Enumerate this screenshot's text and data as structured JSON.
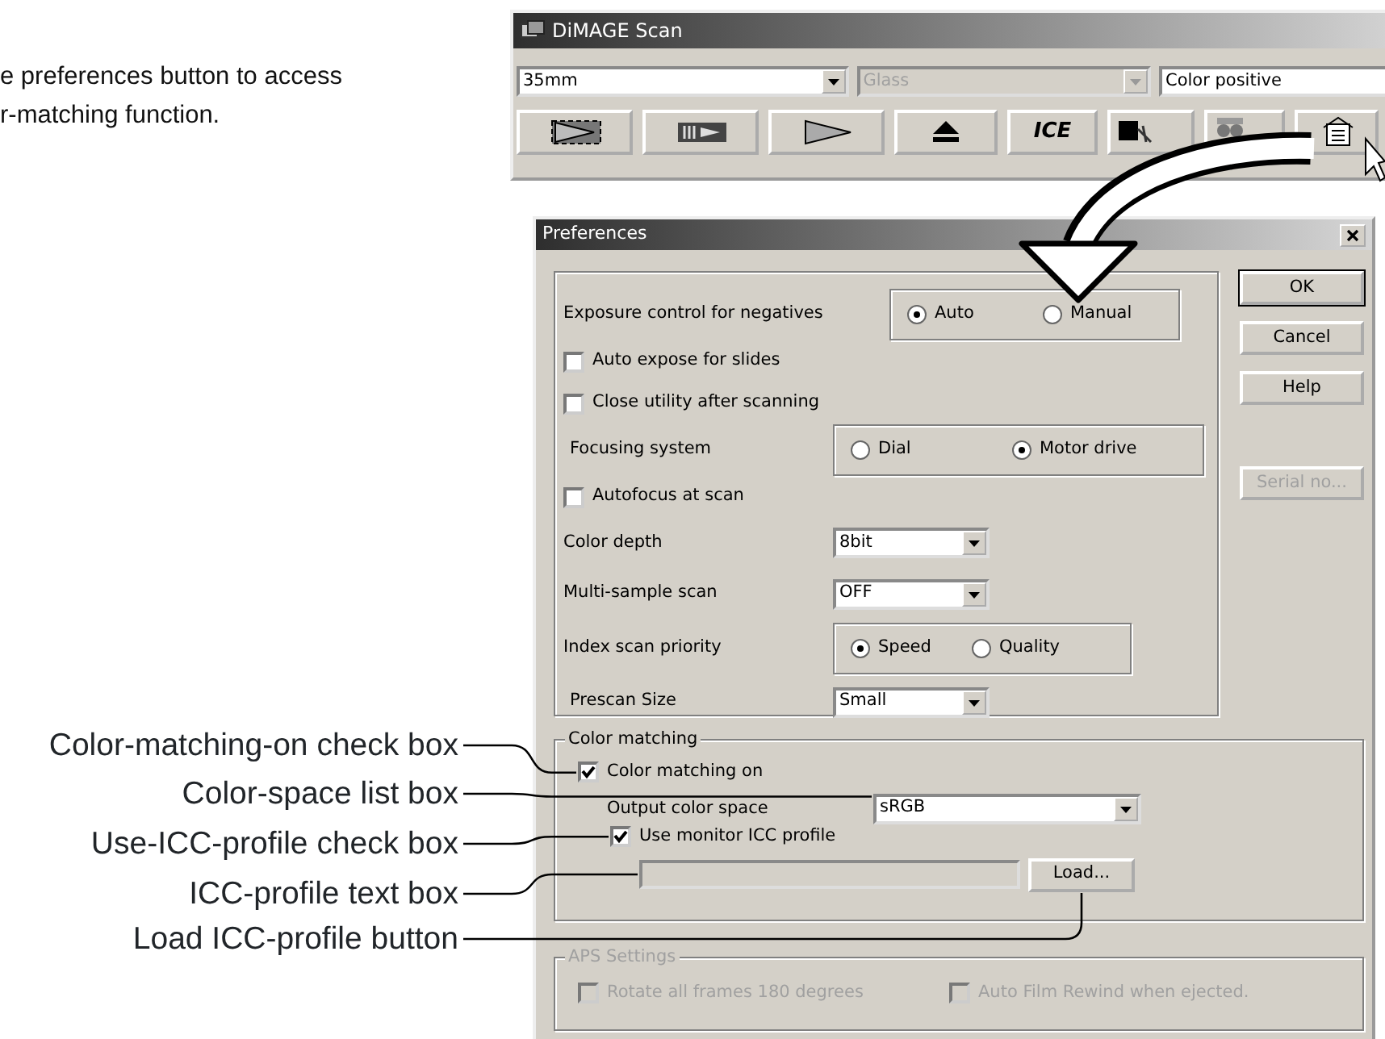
{
  "intro_lines": [
    "e preferences button to access",
    "r-matching function."
  ],
  "main_window": {
    "title": "DiMAGE Scan",
    "dropdowns": [
      {
        "value": "35mm",
        "disabled": false
      },
      {
        "value": "Glass",
        "disabled": true
      },
      {
        "value": "Color positive",
        "disabled": false
      }
    ],
    "toolbar_buttons": [
      {
        "kind": "index"
      },
      {
        "kind": "prescan"
      },
      {
        "kind": "scan"
      },
      {
        "kind": "eject"
      },
      {
        "kind": "ice",
        "label": "ICE"
      },
      {
        "kind": "dust"
      },
      {
        "kind": "grain"
      },
      {
        "kind": "preferences"
      }
    ]
  },
  "preferences_dialog": {
    "title": "Preferences",
    "settings": [
      {
        "kind": "radio",
        "label": "Exposure control for negatives",
        "options": [
          {
            "label": "Auto",
            "selected": true
          },
          {
            "label": "Manual",
            "selected": false
          }
        ]
      },
      {
        "kind": "checkbox",
        "label": "Auto expose for slides",
        "checked": false
      },
      {
        "kind": "checkbox",
        "label": "Close utility after scanning",
        "checked": false
      },
      {
        "kind": "radio",
        "label": "Focusing system",
        "options": [
          {
            "label": "Dial",
            "selected": false
          },
          {
            "label": "Motor drive",
            "selected": true
          }
        ]
      },
      {
        "kind": "checkbox",
        "label": "Autofocus at scan",
        "checked": false
      },
      {
        "kind": "select",
        "label": "Color depth",
        "value": "8bit"
      },
      {
        "kind": "select",
        "label": "Multi-sample scan",
        "value": "OFF"
      },
      {
        "kind": "radio",
        "label": "Index scan priority",
        "options": [
          {
            "label": "Speed",
            "selected": true
          },
          {
            "label": "Quality",
            "selected": false
          }
        ]
      },
      {
        "kind": "select",
        "label": "Prescan Size",
        "value": "Small"
      }
    ],
    "buttons": [
      {
        "label": "OK",
        "default": true,
        "disabled": false
      },
      {
        "label": "Cancel",
        "default": false,
        "disabled": false
      },
      {
        "label": "Help",
        "default": false,
        "disabled": false
      },
      {
        "label": "Serial no...",
        "default": false,
        "disabled": true
      }
    ],
    "color_matching": {
      "title": "Color matching",
      "color_matching_on": {
        "label": "Color matching on",
        "checked": true
      },
      "output_color_space": {
        "label": "Output color space",
        "value": "sRGB"
      },
      "use_monitor_profile": {
        "label": "Use monitor ICC profile",
        "checked": true
      },
      "load_button": "Load..."
    },
    "aps_settings": {
      "title": "APS Settings",
      "disabled": true,
      "options": [
        {
          "label": "Rotate all frames 180 degrees",
          "checked": false
        },
        {
          "label": "Auto Film Rewind when ejected.",
          "checked": false
        }
      ]
    }
  },
  "callouts": [
    "Color-matching-on check box",
    "Color-space list box",
    "Use-ICC-profile check box",
    "ICC-profile text box",
    "Load ICC-profile button"
  ]
}
